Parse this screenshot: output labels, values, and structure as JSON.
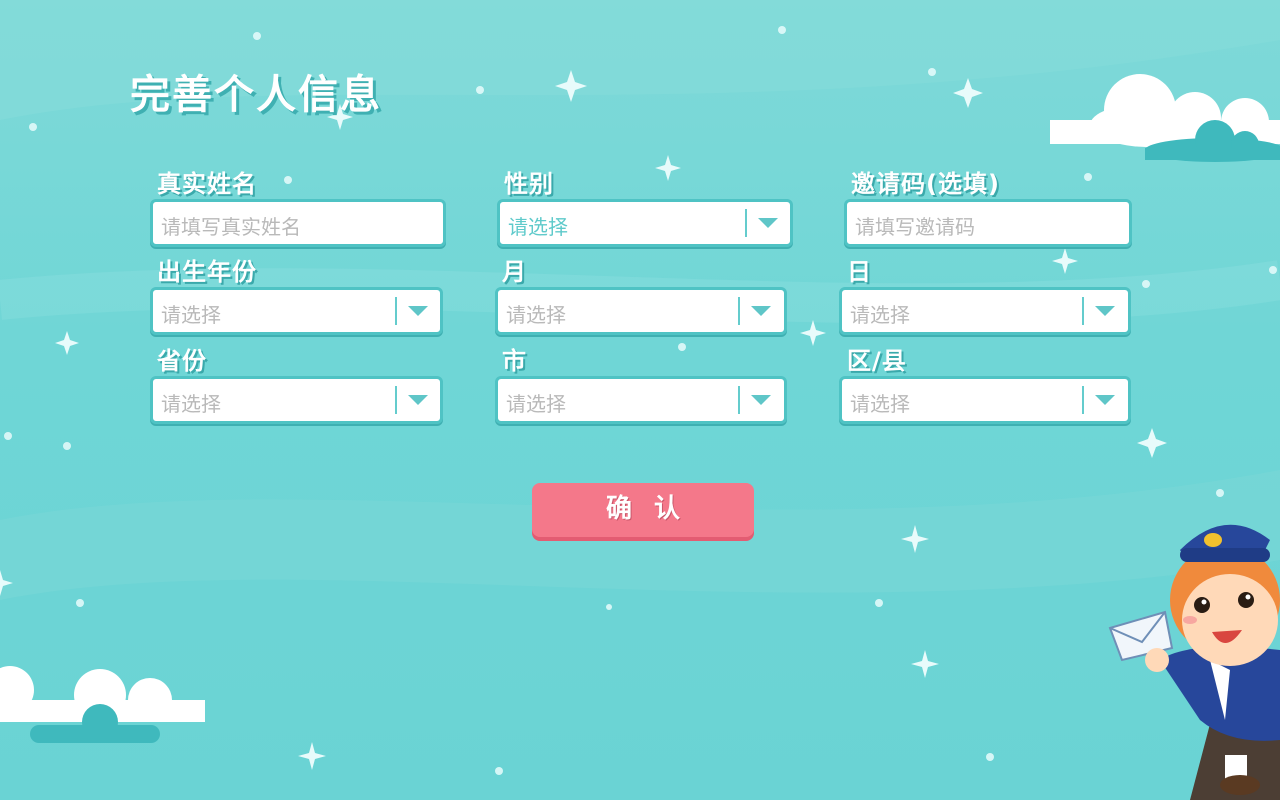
{
  "title": "完善个人信息",
  "colors": {
    "background": "#6fd6d6",
    "field_border": "#4fc3c4",
    "button": "#f4788a",
    "placeholder": "#b9b9b9"
  },
  "fields": {
    "real_name": {
      "label": "真实姓名",
      "placeholder": "请填写真实姓名"
    },
    "gender": {
      "label": "性别",
      "value": "请选择"
    },
    "invite_code": {
      "label": "邀请码(选填)",
      "placeholder": "请填写邀请码"
    },
    "birth_year": {
      "label": "出生年份",
      "value": "请选择"
    },
    "month": {
      "label": "月",
      "value": "请选择"
    },
    "day": {
      "label": "日",
      "value": "请选择"
    },
    "province": {
      "label": "省份",
      "value": "请选择"
    },
    "city": {
      "label": "市",
      "value": "请选择"
    },
    "district": {
      "label": "区/县",
      "value": "请选择"
    }
  },
  "confirm_label": "确认",
  "icons": [
    "chevron-down-icon",
    "cloud-icon",
    "sparkle-icon",
    "mascot-mailman"
  ]
}
